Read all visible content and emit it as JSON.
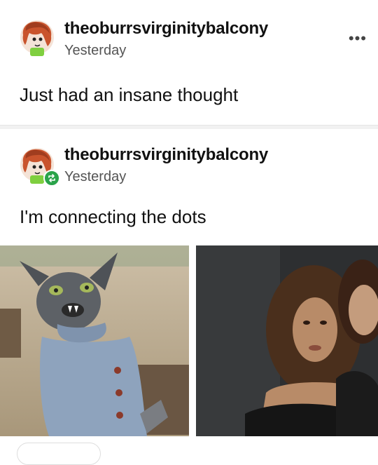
{
  "posts": [
    {
      "username": "theoburrsvirginitybalcony",
      "time": "Yesterday",
      "text": "Just had an insane thought",
      "more_label": "•••"
    },
    {
      "username": "theoburrsvirginitybalcony",
      "time": "Yesterday",
      "text": "I'm connecting the dots"
    }
  ],
  "colors": {
    "reblog_badge": "#2aa34a",
    "divider": "#f1f1f1"
  },
  "icons": [
    "avatar-icon",
    "more-options-icon",
    "reblog-icon"
  ]
}
